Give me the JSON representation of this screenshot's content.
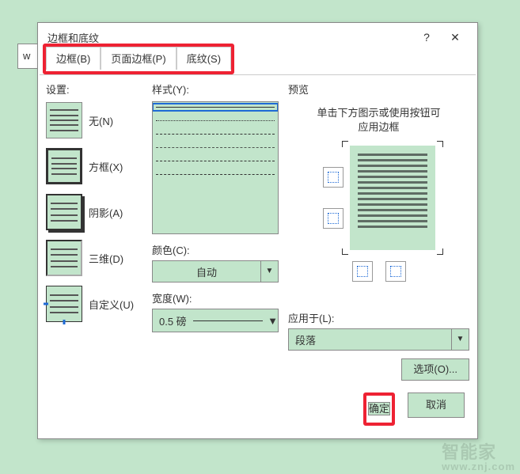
{
  "background_label": "w",
  "dialog": {
    "title": "边框和底纹",
    "help": "?",
    "close": "✕"
  },
  "tabs": {
    "border": "边框(B)",
    "page_border": "页面边框(P)",
    "shading": "底纹(S)"
  },
  "settings": {
    "label": "设置:",
    "none": "无(N)",
    "box": "方框(X)",
    "shadow": "阴影(A)",
    "threeD": "三维(D)",
    "custom": "自定义(U)"
  },
  "style": {
    "label": "样式(Y):",
    "color_label": "颜色(C):",
    "color_value": "自动",
    "width_label": "宽度(W):",
    "width_value": "0.5 磅"
  },
  "preview": {
    "label": "预览",
    "note1": "单击下方图示或使用按钮可",
    "note2": "应用边框",
    "apply_to_label": "应用于(L):",
    "apply_to_value": "段落",
    "options": "选项(O)..."
  },
  "buttons": {
    "ok": "确定",
    "cancel": "取消"
  },
  "watermark": {
    "main": "智能家",
    "sub": "www.znj.com"
  }
}
